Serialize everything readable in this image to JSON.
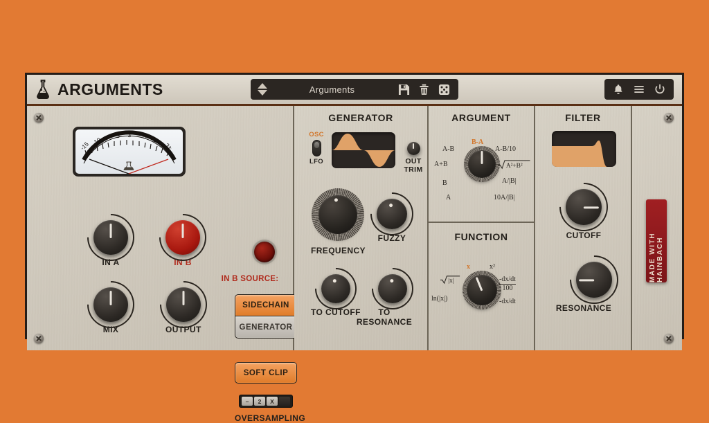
{
  "app": {
    "title": "ARGUMENTS",
    "logo_icon": "flask-icon",
    "background_color": "#e27a33",
    "panel_color": "#cdc6b9",
    "accent_color": "#e07c2a",
    "red_color": "#b02a1c"
  },
  "titlebar": {
    "preset_name": "Arguments",
    "prev_icon": "chevron-up-icon",
    "next_icon": "chevron-down-icon",
    "save_icon": "floppy-disk-icon",
    "delete_icon": "trash-icon",
    "random_icon": "dice-icon",
    "bell_icon": "bell-icon",
    "menu_icon": "hamburger-menu-icon",
    "power_icon": "power-icon"
  },
  "io": {
    "vu_meter": {
      "name": "vu-meter",
      "ticks": [
        "-15",
        "10",
        "7",
        "5",
        "3",
        "0",
        "1",
        "3+"
      ],
      "needle_position": "left"
    },
    "led": {
      "name": "clip-led",
      "state": "off"
    },
    "knobs": [
      {
        "label": "IN A",
        "name": "in-a-knob",
        "angle": 0,
        "style": "dark"
      },
      {
        "label": "IN B",
        "name": "in-b-knob",
        "angle": 0,
        "style": "red",
        "label_color": "red"
      },
      {
        "label": "MIX",
        "name": "mix-knob",
        "angle": 0,
        "style": "dark"
      },
      {
        "label": "OUTPUT",
        "name": "output-knob",
        "angle": 0,
        "style": "dark"
      }
    ],
    "in_b_source": {
      "heading": "IN B SOURCE:",
      "options": [
        {
          "label": "SIDECHAIN",
          "name": "sidechain-button",
          "active": true
        },
        {
          "label": "GENERATOR",
          "name": "source-generator-button",
          "active": false
        }
      ]
    },
    "soft_clip": {
      "label": "SOFT CLIP",
      "name": "soft-clip-button",
      "active": true
    },
    "oversampling": {
      "label": "OVERSAMPLING",
      "segments": [
        "–",
        "2",
        "X",
        ""
      ],
      "selected_index": 1
    }
  },
  "generator": {
    "title": "GENERATOR",
    "mode_switch": {
      "name": "osc-lfo-switch",
      "top_label": "OSC",
      "bottom_label": "LFO",
      "selected": "OSC"
    },
    "wave_display": {
      "name": "waveform-display",
      "shape": "sine"
    },
    "out_trim": {
      "label": "OUT TRIM",
      "name": "out-trim-knob",
      "angle": 0
    },
    "knobs": [
      {
        "label": "FREQUENCY",
        "name": "frequency-knob",
        "angle": -18,
        "big": true
      },
      {
        "label": "FUZZY",
        "name": "fuzzy-knob",
        "angle": -10
      },
      {
        "label": "TO CUTOFF",
        "name": "to-cutoff-knob",
        "angle": -12
      },
      {
        "label": "TO RESONANCE",
        "name": "to-resonance-knob",
        "angle": -8
      }
    ]
  },
  "argument": {
    "title": "ARGUMENT",
    "knob_name": "argument-selector-knob",
    "angle": 0,
    "selected": "B-A",
    "options": [
      {
        "label": "A",
        "name": "argument-option-a"
      },
      {
        "label": "B",
        "name": "argument-option-b"
      },
      {
        "label": "A+B",
        "name": "argument-option-a-plus-b"
      },
      {
        "label": "A-B",
        "name": "argument-option-a-minus-b"
      },
      {
        "label": "B-A",
        "name": "argument-option-b-minus-a"
      },
      {
        "label": "A-B/10",
        "name": "argument-option-a-minus-b-over-10"
      },
      {
        "label": "√A²+B²",
        "name": "argument-option-sqrt-a2-b2"
      },
      {
        "label": "A/|B|",
        "name": "argument-option-a-over-abs-b"
      },
      {
        "label": "10A/|B|",
        "name": "argument-option-10a-over-abs-b"
      }
    ]
  },
  "function": {
    "title": "FUNCTION",
    "knob_name": "function-selector-knob",
    "angle": -22,
    "selected": "x",
    "options": [
      {
        "label": "ln(|x|)",
        "name": "function-option-ln-abs-x"
      },
      {
        "label": "√|x|",
        "name": "function-option-sqrt-abs-x"
      },
      {
        "label": "x",
        "name": "function-option-x"
      },
      {
        "label": "x²",
        "name": "function-option-x-squared"
      },
      {
        "label": "-dx/dt",
        "name": "function-option-dxdt-over-100",
        "sub": "100"
      },
      {
        "label": "-dx/dt",
        "name": "function-option-dxdt"
      }
    ]
  },
  "filter": {
    "title": "FILTER",
    "curve_display": {
      "name": "filter-curve-display",
      "shape": "lowpass-resonant"
    },
    "knobs": [
      {
        "label": "CUTOFF",
        "name": "cutoff-knob",
        "angle": 90
      },
      {
        "label": "RESONANCE",
        "name": "resonance-knob",
        "angle": -90
      }
    ]
  },
  "banner": {
    "text": "MADE WITH HAINBACH",
    "name": "hainbach-banner"
  }
}
